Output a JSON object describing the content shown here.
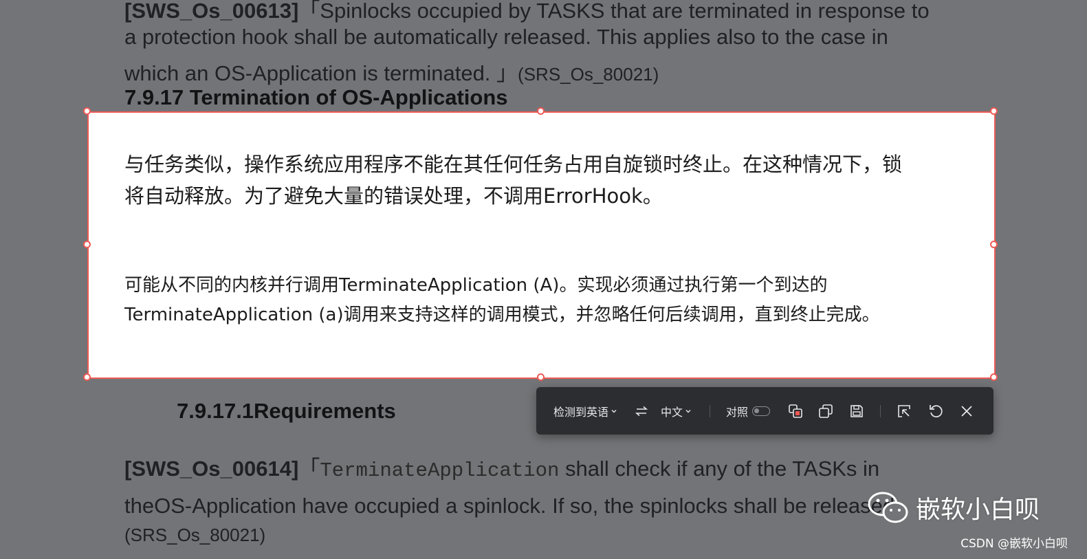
{
  "document": {
    "para1_req": "[SWS_Os_00613]",
    "para1_line1": "「Spinlocks occupied by TASKS that are terminated in response to",
    "para1_line2": "a protection hook shall be automatically released. This applies also to the case in",
    "para1_line3": "which an OS-Application is terminated. 」",
    "para1_src": "(SRS_Os_80021)",
    "heading": "7.9.17 Termination of OS-Applications",
    "subheading": "7.9.17.1Requirements",
    "para2_req": "[SWS_Os_00614]",
    "para2_bracket": "「",
    "para2_code": "TerminateApplication",
    "para2_line1_rest": " shall check if any of the TASKs in",
    "para2_line2": "theOS-Application have occupied a spinlock. If so, the spinlocks shall be released.",
    "para2_src": "(SRS_Os_80021)"
  },
  "translation": {
    "para1_line1": "与任务类似，操作系统应用程序不能在其任何任务占用自旋锁时终止。在这种情况下，锁",
    "para1_line2": "将自动释放。为了避免大量的错误处理，不调用ErrorHook。",
    "para2_line1": "可能从不同的内核并行调用TerminateApplication (A)。实现必须通过执行第一个到达的",
    "para2_line2": "TerminateApplication (a)调用来支持这样的调用模式，并忽略任何后续调用，直到终止完成。"
  },
  "toolbar": {
    "source_lang": "检测到英语",
    "target_lang": "中文",
    "compare_label": "对照",
    "compare_enabled": false,
    "icons": [
      "chevron-down-icon",
      "swap-icon",
      "translate-image-icon",
      "copy-icon",
      "save-icon",
      "pin-icon",
      "refresh-icon",
      "close-icon"
    ]
  },
  "watermark": {
    "text": "嵌软小白呗",
    "csdn": "CSDN @嵌软小白呗"
  },
  "colors": {
    "overlay": "#737477",
    "selection_border": "#ee5a55",
    "toolbar_bg": "#2b2d31"
  }
}
